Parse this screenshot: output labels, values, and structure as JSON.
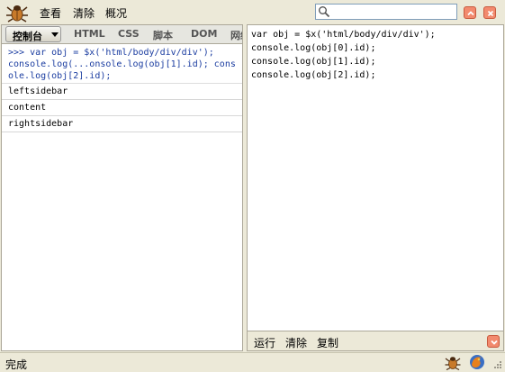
{
  "toolbar": {
    "menu": [
      "查看",
      "清除",
      "概况"
    ],
    "search": {
      "value": "",
      "placeholder": ""
    }
  },
  "tabs": {
    "console_label": "控制台",
    "items": [
      "HTML",
      "CSS",
      "脚本",
      "DOM",
      "网络"
    ]
  },
  "console": {
    "command": ">>> var obj = $x('html/body/div/div');",
    "calls": "console.log(...onsole.log(obj[1].id); console.log(obj[2].id);",
    "rows": [
      "leftsidebar",
      "content",
      "rightsidebar"
    ]
  },
  "editor": {
    "lines": [
      "var obj = $x('html/body/div/div');",
      "console.log(obj[0].id);",
      "console.log(obj[1].id);",
      "console.log(obj[2].id);"
    ],
    "buttons": {
      "run": "运行",
      "clear": "清除",
      "copy": "复制"
    }
  },
  "status": {
    "text": "完成"
  },
  "colors": {
    "chrome": "#ece9d8",
    "command_text": "#1a3ca0",
    "close_button": "#f28a6e"
  },
  "icons": {
    "app": "firebug-icon",
    "search": "search-icon",
    "status_bug": "firebug-icon",
    "status_browser": "firefox-icon",
    "grip": "resize-grip-icon"
  }
}
